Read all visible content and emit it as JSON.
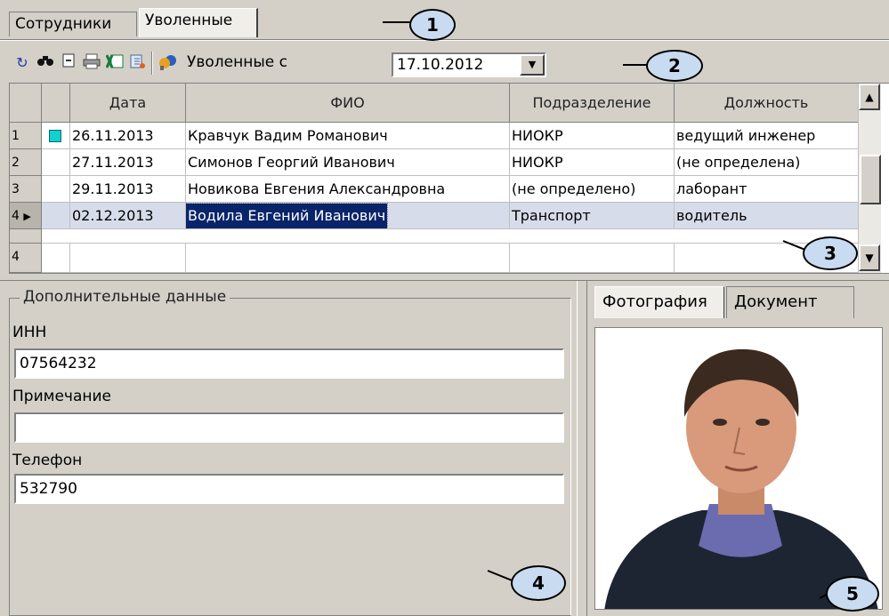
{
  "tabs": [
    "Сотрудники",
    "Уволенные"
  ],
  "callouts": [
    "1",
    "2",
    "3",
    "4",
    "5"
  ],
  "toolbar": {
    "icons": [
      "refresh-icon",
      "binoculars-icon",
      "collapse-icon",
      "print-icon",
      "excel-icon",
      "export-icon",
      "filter-icon"
    ],
    "filter_label": "Уволенные с",
    "date_value": "17.10.2012"
  },
  "grid": {
    "columns": [
      "Дата",
      "ФИО",
      "Подразделение",
      "Должность"
    ],
    "rows": [
      {
        "num": "1",
        "date": "26.11.2013",
        "name": "Кравчук Вадим Романович",
        "dept": "НИОКР",
        "position": "ведущий инженер"
      },
      {
        "num": "2",
        "date": "27.11.2013",
        "name": "Симонов Георгий Иванович",
        "dept": "НИОКР",
        "position": "(не определена)"
      },
      {
        "num": "3",
        "date": "29.11.2013",
        "name": "Новикова Евгения Александровна",
        "dept": "(не определено)",
        "position": "лаборант"
      },
      {
        "num": "4",
        "date": "02.12.2013",
        "name": "Водила Евгений Иванович",
        "dept": "Транспорт",
        "position": "водитель"
      }
    ],
    "footer_num": "4"
  },
  "extra": {
    "title": "Дополнительные данные",
    "inn_label": "ИНН",
    "inn_value": "07564232",
    "note_label": "Примечание",
    "note_value": "",
    "phone_label": "Телефон",
    "phone_value": "532790"
  },
  "right_tabs": [
    "Фотография",
    "Документ"
  ],
  "colors": {
    "callout_fill": "#c9dbf0",
    "selection": "#0a246a",
    "window": "#d4d0c8"
  }
}
